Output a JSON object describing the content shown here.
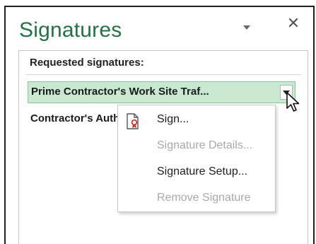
{
  "pane": {
    "title": "Signatures",
    "close_glyph": "✕",
    "dropdown_icon": "chevron-down-icon"
  },
  "requested": {
    "label": "Requested signatures:",
    "items": [
      {
        "text": "Prime Contractor's Work Site Traf...",
        "selected": true
      },
      {
        "text": "Contractor's Authorized Representative",
        "selected": false
      }
    ]
  },
  "context_menu": {
    "items": [
      {
        "label": "Sign...",
        "enabled": true,
        "icon": "signature-document-icon"
      },
      {
        "label": "Signature Details...",
        "enabled": false
      },
      {
        "label": "Signature Setup...",
        "enabled": true
      },
      {
        "label": "Remove Signature",
        "enabled": false
      }
    ]
  },
  "colors": {
    "title": "#217346",
    "selection_fill": "#c8e9d0",
    "selection_border": "#86c49a",
    "disabled_text": "#a9a9a9",
    "icon_red": "#c0392b"
  }
}
